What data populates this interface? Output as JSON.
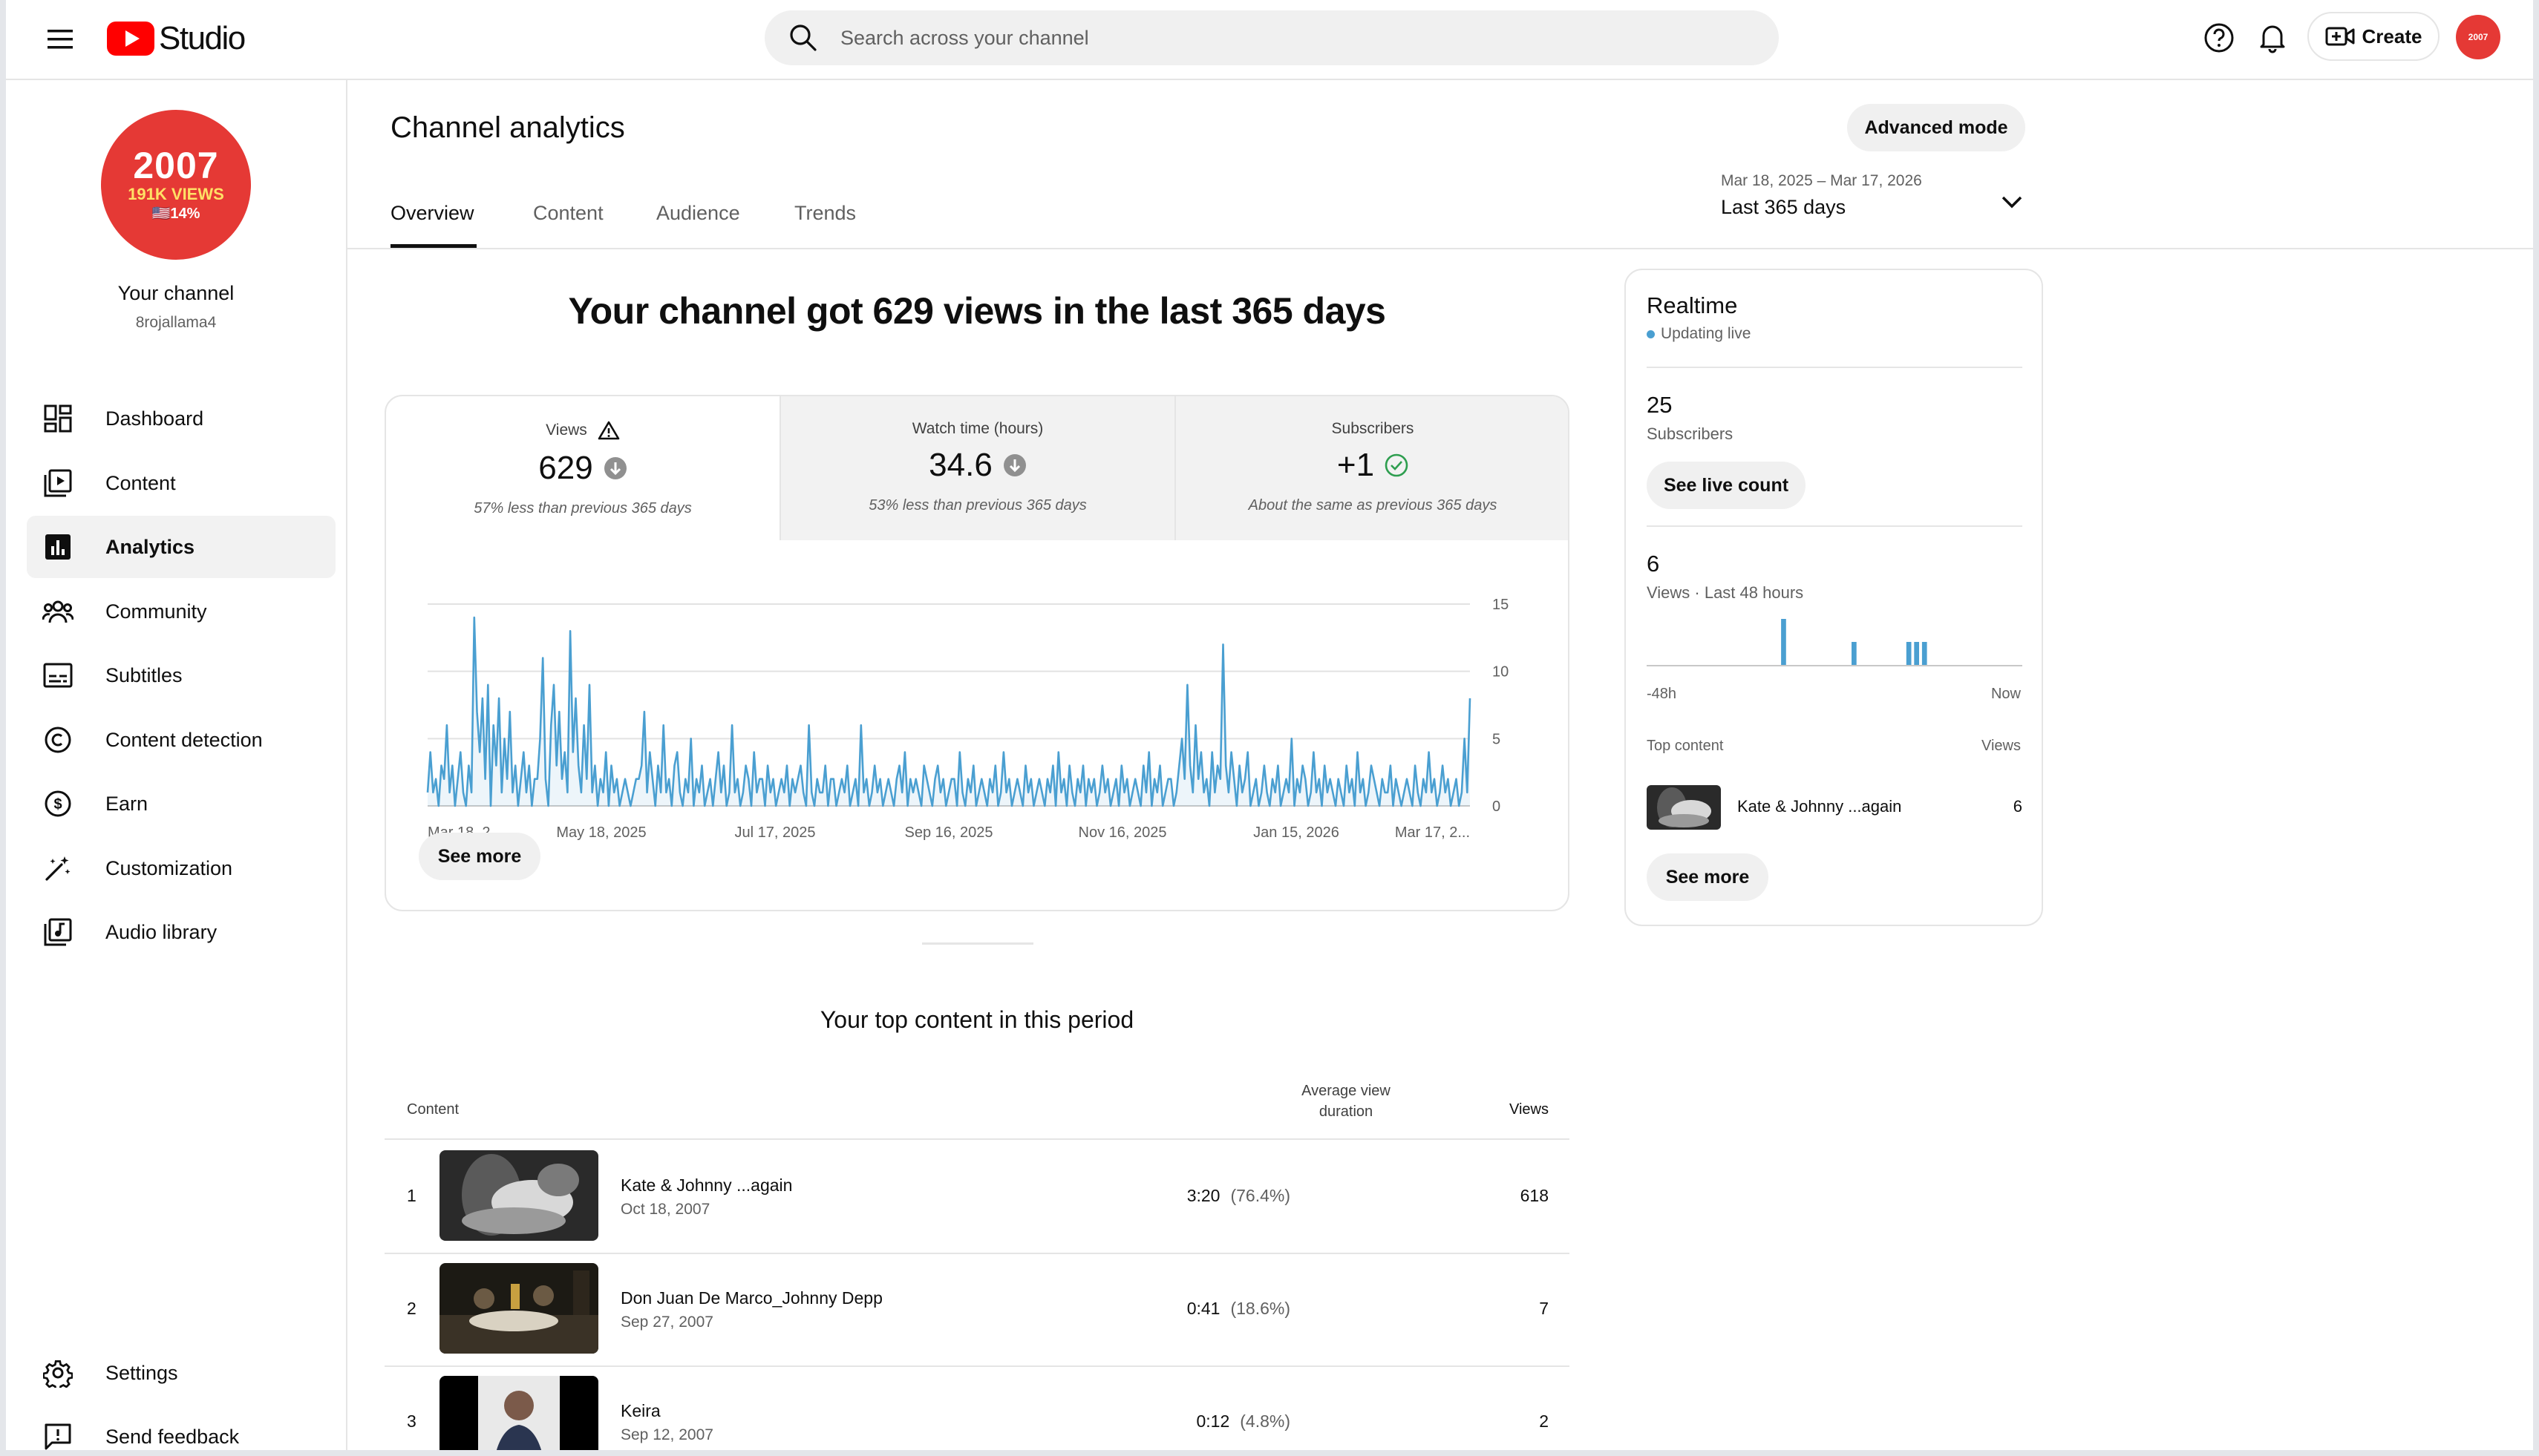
{
  "header": {
    "logo_text": "Studio",
    "search_placeholder": "Search across your channel",
    "create_label": "Create",
    "avatar_text": "2007"
  },
  "sidebar": {
    "avatar": {
      "line1": "2007",
      "line2": "191K VIEWS",
      "line3": "🇺🇸14%"
    },
    "channel_label": "Your channel",
    "handle": "8rojallama4",
    "items": [
      {
        "label": "Dashboard",
        "icon": "dashboard-icon"
      },
      {
        "label": "Content",
        "icon": "content-icon"
      },
      {
        "label": "Analytics",
        "icon": "analytics-icon",
        "active": true
      },
      {
        "label": "Community",
        "icon": "community-icon"
      },
      {
        "label": "Subtitles",
        "icon": "subtitles-icon"
      },
      {
        "label": "Content detection",
        "icon": "copyright-icon"
      },
      {
        "label": "Earn",
        "icon": "dollar-icon"
      },
      {
        "label": "Customization",
        "icon": "magic-wand-icon"
      },
      {
        "label": "Audio library",
        "icon": "audio-library-icon"
      }
    ],
    "bottom_items": [
      {
        "label": "Settings",
        "icon": "gear-icon"
      },
      {
        "label": "Send feedback",
        "icon": "feedback-icon"
      }
    ]
  },
  "page": {
    "title": "Channel analytics",
    "advanced_mode": "Advanced mode",
    "tabs": [
      "Overview",
      "Content",
      "Audience",
      "Trends"
    ],
    "active_tab": "Overview",
    "date_range_sub": "Mar 18, 2025 – Mar 17, 2026",
    "date_range_main": "Last 365 days"
  },
  "overview": {
    "headline": "Your channel got 629 views in the last 365 days",
    "metrics": [
      {
        "label": "Views",
        "value": "629",
        "note": "57% less than previous 365 days",
        "trend": "down",
        "warning": true
      },
      {
        "label": "Watch time (hours)",
        "value": "34.6",
        "note": "53% less than previous 365 days",
        "trend": "down"
      },
      {
        "label": "Subscribers",
        "value": "+1",
        "note": "About the same as previous 365 days",
        "trend": "same"
      }
    ],
    "see_more": "See more"
  },
  "chart_data": {
    "type": "line",
    "title": "",
    "xlabel": "",
    "ylabel": "",
    "x_tick_labels": [
      "Mar 18, 2...",
      "May 18, 2025",
      "Jul 17, 2025",
      "Sep 16, 2025",
      "Nov 16, 2025",
      "Jan 15, 2026",
      "Mar 17, 2..."
    ],
    "y_ticks": [
      0,
      5,
      10,
      15
    ],
    "ylim": [
      0,
      15
    ],
    "grid": true,
    "color": "#4a9fd1",
    "series": [
      {
        "name": "",
        "values": [
          1,
          4,
          1,
          2,
          0,
          3,
          2,
          6,
          1,
          3,
          0,
          2,
          4,
          1,
          0,
          3,
          1,
          14,
          7,
          4,
          8,
          2,
          9,
          0,
          6,
          3,
          8,
          1,
          5,
          2,
          7,
          1,
          3,
          0,
          2,
          4,
          1,
          3,
          0,
          2,
          2,
          5,
          11,
          2,
          0,
          6,
          9,
          3,
          7,
          2,
          4,
          1,
          13,
          4,
          8,
          3,
          1,
          6,
          2,
          9,
          1,
          3,
          0,
          2,
          1,
          4,
          0,
          3,
          1,
          2,
          0,
          1,
          2,
          1,
          0,
          1,
          2,
          2,
          3,
          7,
          1,
          4,
          2,
          0,
          3,
          1,
          6,
          1,
          2,
          0,
          3,
          4,
          1,
          0,
          2,
          1,
          5,
          0,
          2,
          1,
          3,
          0,
          1,
          2,
          0,
          2,
          4,
          1,
          3,
          0,
          1,
          6,
          1,
          2,
          0,
          1,
          3,
          2,
          0,
          4,
          1,
          2,
          2,
          0,
          3,
          1,
          2,
          0,
          1,
          2,
          1,
          3,
          0,
          2,
          1,
          2,
          3,
          1,
          0,
          6,
          1,
          0,
          2,
          1,
          1,
          3,
          0,
          2,
          2,
          0,
          1,
          2,
          1,
          3,
          0,
          1,
          2,
          0,
          6,
          1,
          2,
          0,
          1,
          3,
          1,
          2,
          0,
          1,
          2,
          1,
          0,
          2,
          3,
          1,
          4,
          0,
          2,
          1,
          2,
          1,
          0,
          3,
          2,
          1,
          0,
          2,
          3,
          1,
          2,
          0,
          1,
          2,
          2,
          0,
          4,
          1,
          0,
          2,
          1,
          3,
          0,
          1,
          2,
          1,
          0,
          2,
          1,
          3,
          0,
          1,
          4,
          1,
          2,
          0,
          1,
          2,
          1,
          0,
          3,
          1,
          2,
          0,
          1,
          2,
          1,
          0,
          2,
          1,
          3,
          0,
          4,
          1,
          2,
          0,
          3,
          1,
          0,
          2,
          1,
          3,
          0,
          2,
          1,
          2,
          0,
          1,
          3,
          1,
          2,
          0,
          1,
          2,
          0,
          3,
          1,
          2,
          0,
          1,
          2,
          1,
          0,
          3,
          1,
          4,
          0,
          2,
          1,
          3,
          0,
          1,
          2,
          2,
          0,
          1,
          3,
          5,
          2,
          9,
          3,
          1,
          6,
          2,
          4,
          1,
          2,
          0,
          4,
          1,
          3,
          2,
          12,
          3,
          1,
          4,
          2,
          0,
          3,
          1,
          2,
          4,
          0,
          1,
          2,
          0,
          1,
          3,
          1,
          0,
          2,
          1,
          3,
          0,
          1,
          2,
          1,
          5,
          0,
          2,
          1,
          3,
          2,
          0,
          1,
          4,
          1,
          2,
          0,
          3,
          1,
          2,
          1,
          0,
          2,
          1,
          0,
          3,
          1,
          2,
          0,
          4,
          1,
          2,
          0,
          1,
          3,
          2,
          1,
          0,
          2,
          1,
          1,
          3,
          0,
          2,
          1,
          0,
          1,
          2,
          1,
          0,
          3,
          1,
          0,
          2,
          1,
          4,
          1,
          2,
          0,
          1,
          3,
          1,
          2,
          0,
          1,
          2,
          0,
          1,
          5,
          1,
          8
        ]
      }
    ]
  },
  "top_content": {
    "title": "Your top content in this period",
    "columns": {
      "content": "Content",
      "avd": "Average view duration",
      "views": "Views"
    },
    "rows": [
      {
        "rank": "1",
        "title": "Kate & Johnny ...again",
        "date": "Oct 18, 2007",
        "duration": "3:20",
        "pct": "(76.4%)",
        "views": "618"
      },
      {
        "rank": "2",
        "title": "Don Juan De Marco_Johnny Depp",
        "date": "Sep 27, 2007",
        "duration": "0:41",
        "pct": "(18.6%)",
        "views": "7"
      },
      {
        "rank": "3",
        "title": "Keira",
        "date": "Sep 12, 2007",
        "duration": "0:12",
        "pct": "(4.8%)",
        "views": "2"
      }
    ]
  },
  "realtime": {
    "title": "Realtime",
    "live_label": "Updating live",
    "subscribers_value": "25",
    "subscribers_label": "Subscribers",
    "see_live_count": "See live count",
    "views_value": "6",
    "views_label": "Views · Last 48 hours",
    "axis_start": "-48h",
    "axis_end": "Now",
    "hourly_views": [
      0,
      0,
      0,
      0,
      0,
      0,
      0,
      0,
      0,
      0,
      0,
      0,
      0,
      0,
      0,
      0,
      0,
      2,
      0,
      0,
      0,
      0,
      0,
      0,
      0,
      0,
      1,
      0,
      0,
      0,
      0,
      0,
      0,
      1,
      1,
      1,
      0,
      0,
      0,
      0,
      0,
      0,
      0,
      0,
      0,
      0,
      0,
      0
    ],
    "top_content_label": "Top content",
    "views_col_label": "Views",
    "top_item_title": "Kate & Johnny ...again",
    "top_item_views": "6",
    "see_more": "See more"
  }
}
